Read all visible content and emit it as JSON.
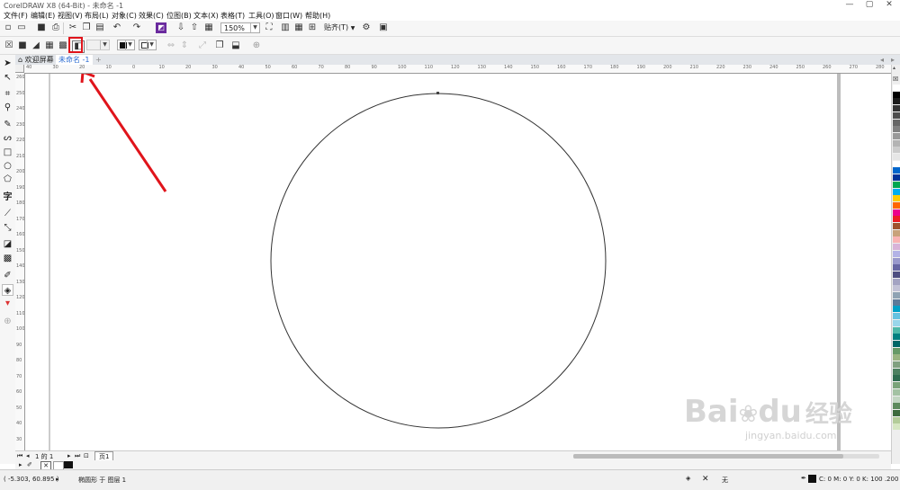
{
  "window": {
    "title": "CorelDRAW X8 (64-Bit) - 未命名 -1",
    "minimize": "—",
    "maximize": "▢",
    "close": "✕"
  },
  "menu": [
    "文件(F)",
    "编辑(E)",
    "视图(V)",
    "布局(L)",
    "对象(C)",
    "效果(C)",
    "位图(B)",
    "文本(X)",
    "表格(T)",
    "工具(O)",
    "窗口(W)",
    "帮助(H)"
  ],
  "toolbar": {
    "zoom": "150%",
    "snap_label": "贴齐(T)"
  },
  "tabs": {
    "welcome": "欢迎屏幕",
    "document": "未命名 -1",
    "add": "+"
  },
  "ruler": {
    "h_ticks": [
      "40",
      "30",
      "20",
      "10",
      "0",
      "10",
      "20",
      "30",
      "40",
      "50",
      "60",
      "70",
      "80",
      "90",
      "100",
      "110",
      "120",
      "130",
      "140",
      "150",
      "160",
      "170",
      "180",
      "190",
      "200",
      "210",
      "220",
      "230",
      "240",
      "250",
      "260",
      "270",
      "280",
      "290",
      "300"
    ],
    "v_ticks": [
      "260",
      "250",
      "240",
      "230",
      "220",
      "210",
      "200",
      "190",
      "180",
      "170",
      "160",
      "150",
      "140",
      "130",
      "120",
      "110",
      "100",
      "90",
      "80",
      "70",
      "60",
      "50",
      "40",
      "30"
    ],
    "unit": "毫米"
  },
  "pages": {
    "label": "1 的 1",
    "tab": "页1"
  },
  "status": {
    "coords": "( -5.303, 60.895 )",
    "object": "椭圆形 于 图层 1",
    "fill": "无",
    "outline": "C: 0 M: 0 Y: 0 K: 100 .200 mm"
  },
  "colors": {
    "highlight": "#e0141b",
    "accent": "#2a6bd1"
  },
  "palette": [
    "#ffffff",
    "#000000",
    "#1a1a1a",
    "#333333",
    "#4d4d4d",
    "#666666",
    "#808080",
    "#999999",
    "#b3b3b3",
    "#cccccc",
    "#e6e6e6",
    "#ffffff",
    "#0066cc",
    "#003399",
    "#00a651",
    "#00aeef",
    "#ffcc00",
    "#ff6600",
    "#ec008c",
    "#ed1c24",
    "#a0522d",
    "#c8a27a",
    "#f9b3b3",
    "#d8b3d8",
    "#b3b3e6",
    "#9999cc",
    "#6666a3",
    "#4d4d80",
    "#a3a3c2",
    "#c2c2d6",
    "#8fa3b3",
    "#5c7a99",
    "#00a0c6",
    "#66c2e0",
    "#99d6ea",
    "#4db8a8",
    "#008080",
    "#006666",
    "#669966",
    "#99b380",
    "#80a080",
    "#4d8060",
    "#2e6b4f",
    "#7aa37a",
    "#a3c2a3",
    "#c2d6c2",
    "#5c8a5c",
    "#3d6b3d",
    "#b3cc99",
    "#d6e6c2"
  ],
  "watermark": {
    "brand": "Bai",
    "brand2": "du",
    "cn": "经验",
    "url": "jingyan.baidu.com"
  }
}
